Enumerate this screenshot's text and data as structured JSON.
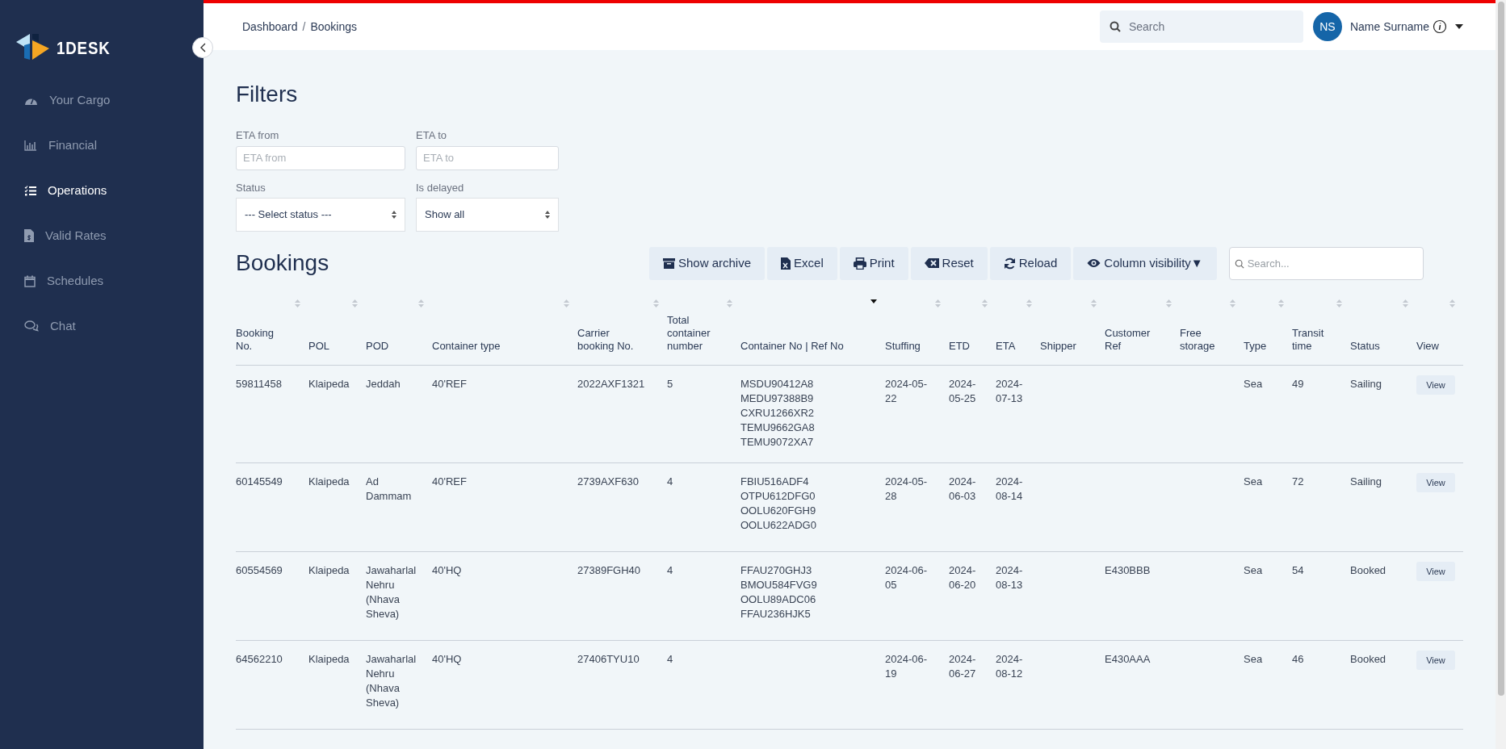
{
  "brand": {
    "name": "1DESK"
  },
  "sidebar": {
    "items": [
      {
        "label": "Your Cargo",
        "selected": false
      },
      {
        "label": "Financial",
        "selected": false
      },
      {
        "label": "Operations",
        "selected": true
      },
      {
        "label": "Valid Rates",
        "selected": false
      },
      {
        "label": "Schedules",
        "selected": false
      },
      {
        "label": "Chat",
        "selected": false
      }
    ]
  },
  "breadcrumb": {
    "items": [
      "Dashboard",
      "Bookings"
    ],
    "separator": "/"
  },
  "header_search": {
    "placeholder": "Search"
  },
  "user": {
    "initials": "NS",
    "name": "Name Surname"
  },
  "filters": {
    "title": "Filters",
    "fields": [
      {
        "kind": "input",
        "label": "ETA from",
        "placeholder": "ETA from"
      },
      {
        "kind": "input",
        "label": "ETA to",
        "placeholder": "ETA to"
      },
      {
        "kind": "select",
        "label": "Status",
        "value": "--- Select status ---"
      },
      {
        "kind": "select",
        "label": "Is delayed",
        "value": "Show all"
      }
    ]
  },
  "bookings": {
    "title": "Bookings",
    "buttons": [
      "Show archive",
      "Excel",
      "Print",
      "Reset",
      "Reload",
      "Column visibility▼"
    ],
    "search": {
      "placeholder": "Search..."
    },
    "columns": [
      {
        "label": "Booking No.",
        "sorted": false
      },
      {
        "label": "POL",
        "sorted": false
      },
      {
        "label": "POD",
        "sorted": false
      },
      {
        "label": "Container type",
        "sorted": false
      },
      {
        "label": "Carrier booking No.",
        "sorted": false
      },
      {
        "label": "Total container number",
        "sorted": false
      },
      {
        "label": "Container No | Ref No",
        "sorted": true
      },
      {
        "label": "Stuffing",
        "sorted": false
      },
      {
        "label": "ETD",
        "sorted": false
      },
      {
        "label": "ETA",
        "sorted": false
      },
      {
        "label": "Shipper",
        "sorted": false
      },
      {
        "label": "Customer Ref",
        "sorted": false
      },
      {
        "label": "Free storage",
        "sorted": false
      },
      {
        "label": "Type",
        "sorted": false
      },
      {
        "label": "Transit time",
        "sorted": false
      },
      {
        "label": "Status",
        "sorted": false
      },
      {
        "label": "View",
        "sorted": false
      }
    ],
    "rows": [
      {
        "cells": [
          "59811458",
          "Klaipeda",
          "Jeddah",
          "40'REF",
          "2022AXF1321",
          "5",
          [
            "MSDU90412A8",
            "MEDU97388B9",
            "CXRU1266XR2",
            "TEMU9662GA8",
            "TEMU9072XA7"
          ],
          "2024-05-22",
          "2024-05-25",
          "2024-07-13",
          null,
          null,
          null,
          "Sea",
          "49",
          "Sailing"
        ],
        "action": "View"
      },
      {
        "cells": [
          "60145549",
          "Klaipeda",
          "Ad Dammam",
          "40'REF",
          "2739AXF630",
          "4",
          [
            "FBIU516ADF4",
            "OTPU612DFG0",
            "OOLU620FGH9",
            "OOLU622ADG0"
          ],
          "2024-05-28",
          "2024-06-03",
          "2024-08-14",
          null,
          null,
          null,
          "Sea",
          "72",
          "Sailing"
        ],
        "action": "View"
      },
      {
        "cells": [
          "60554569",
          "Klaipeda",
          "Jawaharlal Nehru (Nhava Sheva)",
          "40'HQ",
          "27389FGH40",
          "4",
          [
            "FFAU270GHJ3",
            "BMOU584FVG9",
            "OOLU89ADC06",
            "FFAU236HJK5"
          ],
          "2024-06-05",
          "2024-06-20",
          "2024-08-13",
          null,
          "E430BBB",
          null,
          "Sea",
          "54",
          "Booked"
        ],
        "action": "View"
      },
      {
        "cells": [
          "64562210",
          "Klaipeda",
          "Jawaharlal Nehru (Nhava Sheva)",
          "40'HQ",
          "27406TYU10",
          "4",
          null,
          "2024-06-19",
          "2024-06-27",
          "2024-08-12",
          null,
          "E430AAA",
          null,
          "Sea",
          "46",
          "Booked"
        ],
        "action": "View"
      }
    ]
  }
}
